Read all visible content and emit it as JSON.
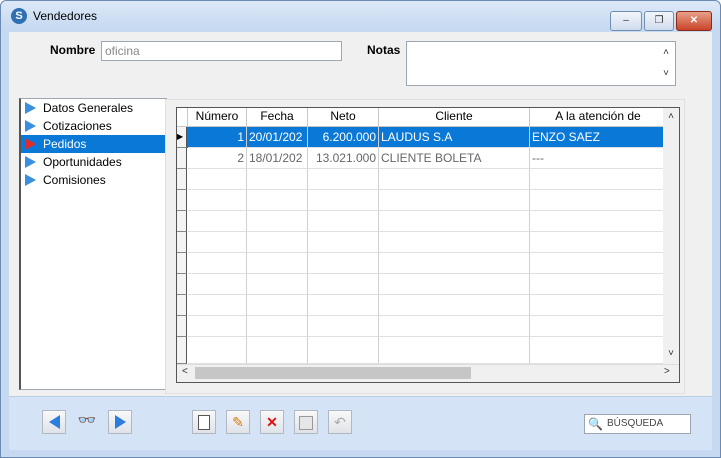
{
  "window": {
    "title": "Vendedores",
    "buttons": {
      "minimize": "–",
      "maximize": "❐",
      "close": "✕"
    }
  },
  "form": {
    "nombre_label": "Nombre",
    "nombre_value": "oficina",
    "notas_label": "Notas",
    "notas_value": ""
  },
  "sidebar": {
    "items": [
      {
        "label": "Datos Generales",
        "selected": false
      },
      {
        "label": "Cotizaciones",
        "selected": false
      },
      {
        "label": "Pedidos",
        "selected": true
      },
      {
        "label": "Oportunidades",
        "selected": false
      },
      {
        "label": "Comisiones",
        "selected": false
      }
    ]
  },
  "grid": {
    "columns": [
      "Número",
      "Fecha",
      "Neto",
      "Cliente",
      "A la atención de"
    ],
    "rows": [
      {
        "numero": "1",
        "fecha": "20/01/202",
        "neto": "6.200.000",
        "cliente": "LAUDUS S.A",
        "atencion": "ENZO SAEZ",
        "selected": true
      },
      {
        "numero": "2",
        "fecha": "18/01/202",
        "neto": "13.021.000",
        "cliente": "CLIENTE BOLETA",
        "atencion": "---",
        "selected": false
      }
    ],
    "current_row_marker": "▶"
  },
  "toolbar": {
    "search_placeholder": "BÚSQUEDA"
  },
  "colors": {
    "selection": "#0a78d7",
    "title_bg": "#c4d8f0",
    "footer_bg": "#d4e3f5"
  }
}
